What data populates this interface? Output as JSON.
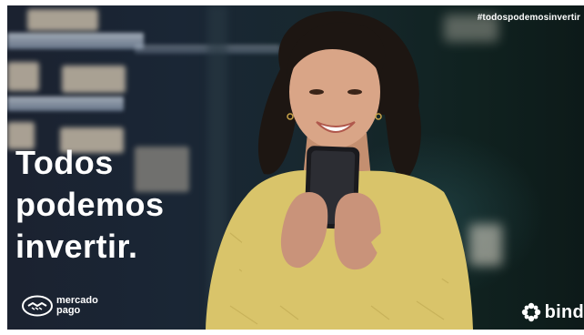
{
  "ad": {
    "hashtag": "#todospodemosinvertir",
    "headline": [
      "Todos",
      "podemos",
      "invertir."
    ],
    "logos": {
      "left_line1": "mercado",
      "left_line2": "pago",
      "right": "bind"
    }
  },
  "colors": {
    "text": "#ffffff",
    "sweater": "#d9c46a",
    "background": "#172630"
  }
}
